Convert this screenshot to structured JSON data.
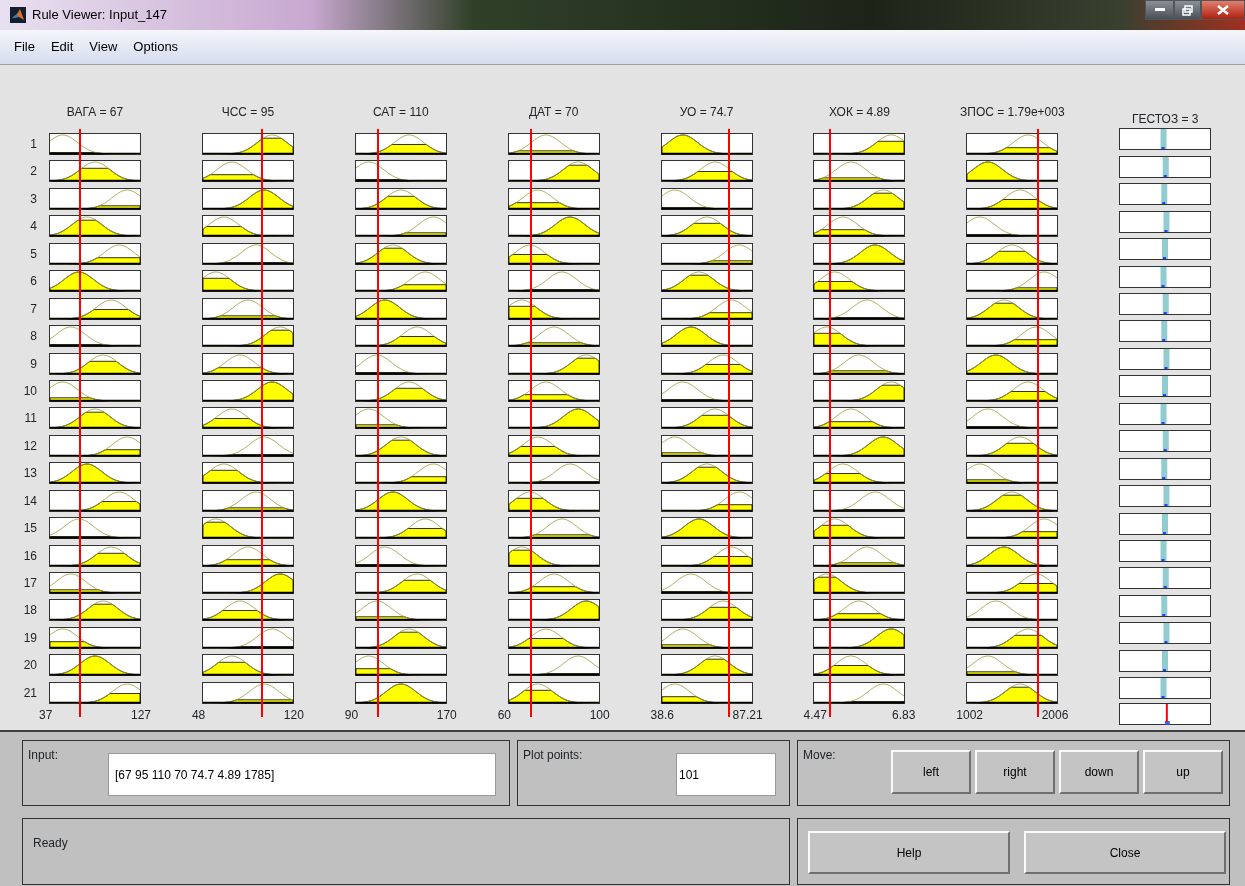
{
  "window": {
    "title": "Rule Viewer: Input_147"
  },
  "menu": [
    "File",
    "Edit",
    "View",
    "Options"
  ],
  "rules": [
    "1",
    "2",
    "3",
    "4",
    "5",
    "6",
    "7",
    "8",
    "9",
    "10",
    "11",
    "12",
    "13",
    "14",
    "15",
    "16",
    "17",
    "18",
    "19",
    "20",
    "21"
  ],
  "inputs": [
    {
      "label": "ВАГА = 67",
      "min": "37",
      "max": "127"
    },
    {
      "label": "ЧСС = 95",
      "min": "48",
      "max": "120"
    },
    {
      "label": "САТ = 110",
      "min": "90",
      "max": "170"
    },
    {
      "label": "ДАТ = 70",
      "min": "60",
      "max": "100"
    },
    {
      "label": "УО = 74.7",
      "min": "38.6",
      "max": "87.21"
    },
    {
      "label": "ХОК = 4.89",
      "min": "4.47",
      "max": "6.83"
    },
    {
      "label": "ЗПОС = 1.79e+003",
      "min": "1002",
      "max": "2006"
    }
  ],
  "output": {
    "label": "ГЕСТОЗ = 3"
  },
  "input_field": {
    "label": "Input:",
    "value": "[67 95 110 70 74.7 4.89 1785]"
  },
  "plot_points": {
    "label": "Plot points:",
    "value": "101"
  },
  "move": {
    "label": "Move:",
    "buttons": [
      "left",
      "right",
      "down",
      "up"
    ]
  },
  "status": "Ready",
  "buttons": [
    "Help",
    "Close"
  ]
}
